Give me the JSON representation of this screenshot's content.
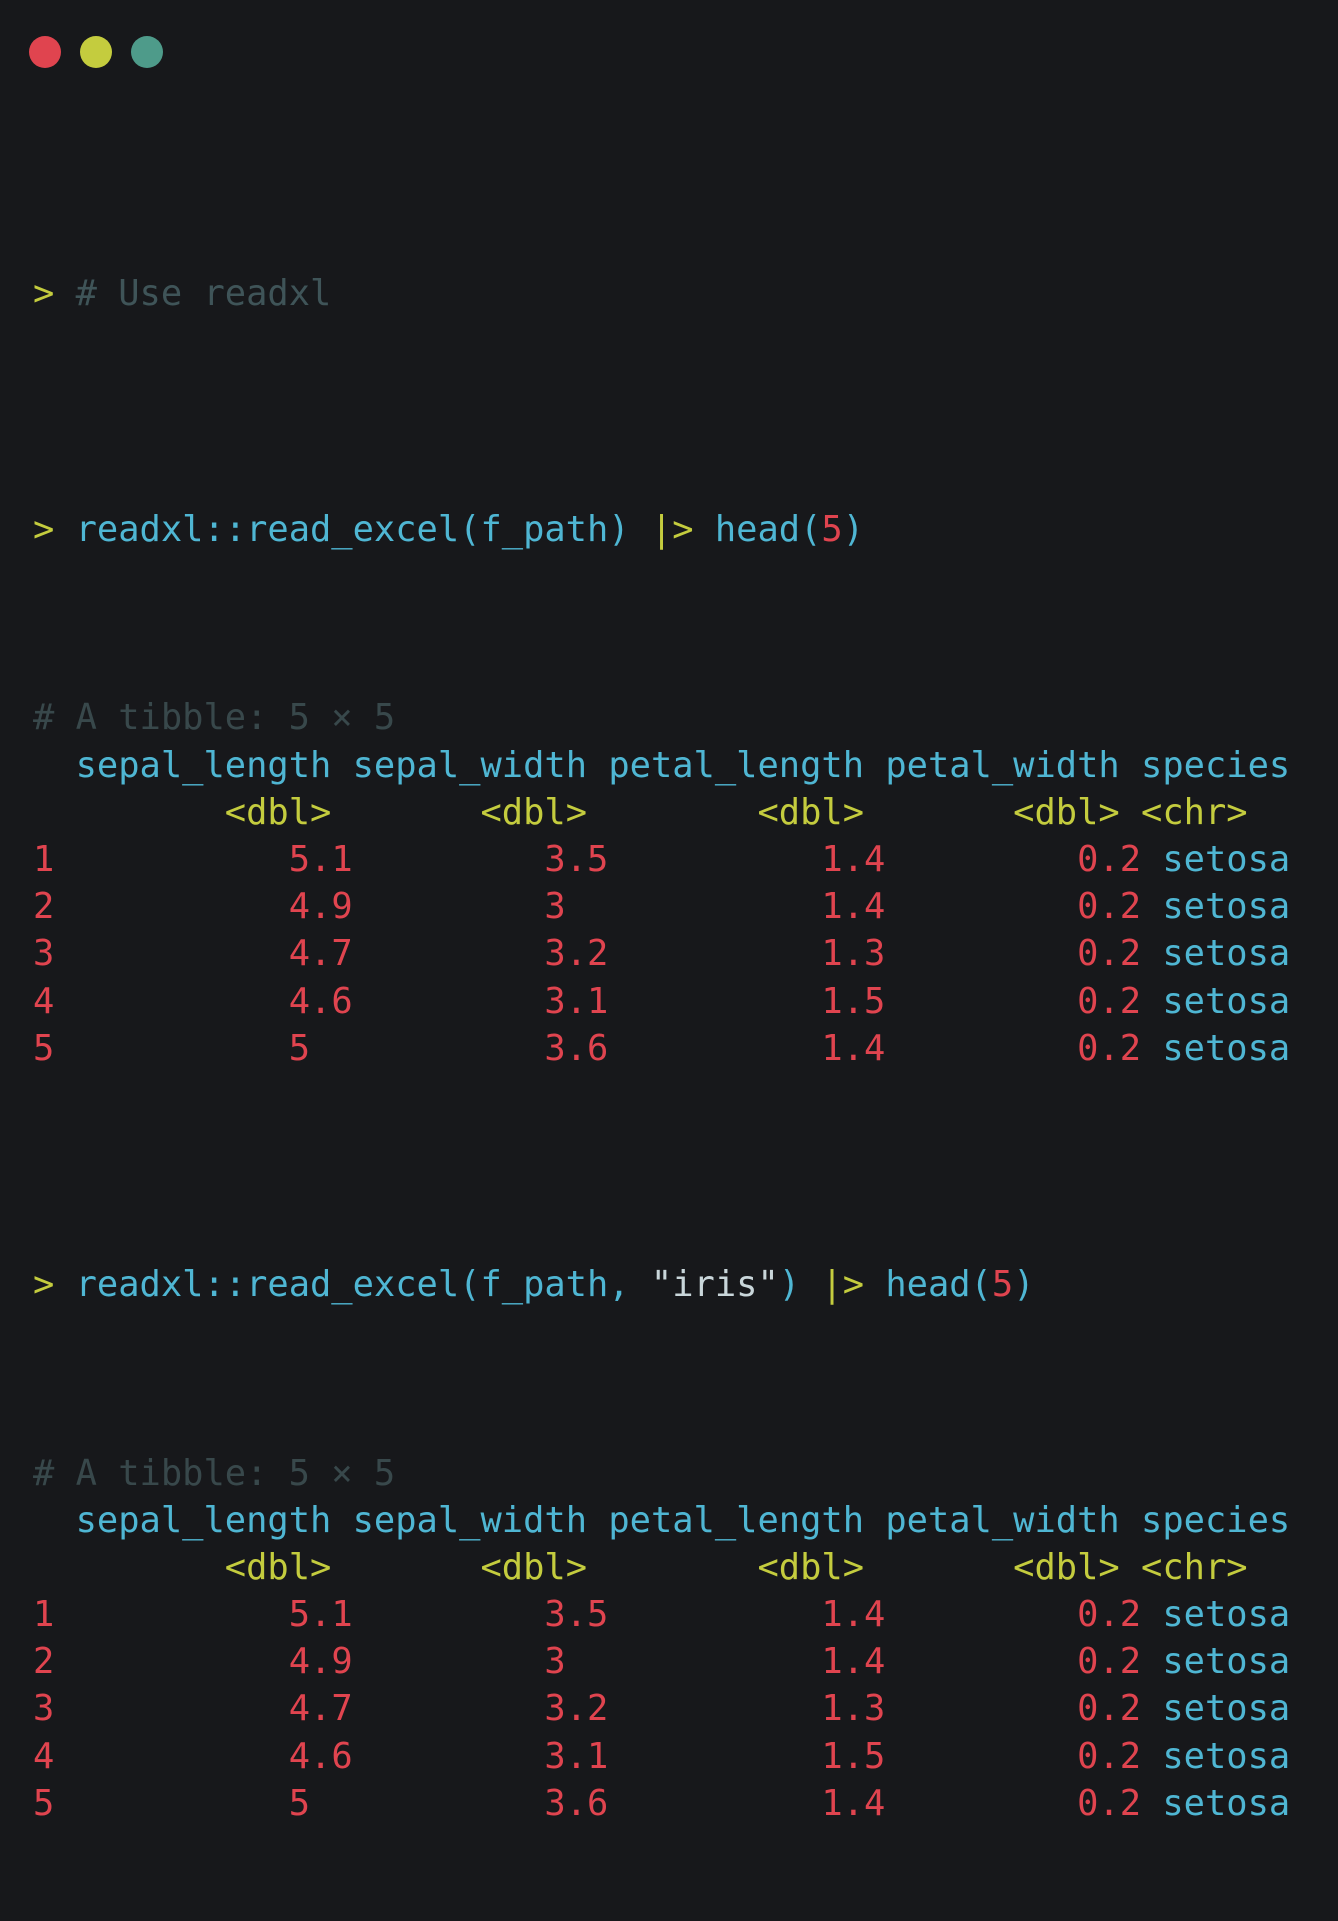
{
  "window_controls": {
    "close_color": "#e0444f",
    "minimize_color": "#c4cc3e",
    "zoom_color": "#4e9b8a"
  },
  "colors": {
    "background": "#17181b",
    "prompt": "#c4cc3e",
    "code": "#4fb6d3",
    "number": "#e0444f",
    "comment": "#3f5458"
  },
  "prompt": ">",
  "comment_line": "# Use readxl",
  "command1": {
    "fn": "readxl::read_excel(f_path)",
    "pipe": "|>",
    "head_fn": "head(",
    "head_arg": "5",
    "close": ")"
  },
  "command2": {
    "fn_open": "readxl::read_excel(f_path, ",
    "arg": "\"iris\"",
    "fn_close": ")",
    "pipe": "|>",
    "head_fn": "head(",
    "head_arg": "5",
    "close": ")"
  },
  "tibble_header": "# A tibble: 5 × 5",
  "columns": [
    "sepal_length",
    "sepal_width",
    "petal_length",
    "petal_width",
    "species"
  ],
  "types": [
    "<dbl>",
    "<dbl>",
    "<dbl>",
    "<dbl>",
    "<chr>"
  ],
  "rows": [
    {
      "n": "1",
      "sepal_length": "5.1",
      "sepal_width": "3.5",
      "petal_length": "1.4",
      "petal_width": "0.2",
      "species": "setosa"
    },
    {
      "n": "2",
      "sepal_length": "4.9",
      "sepal_width": "3",
      "petal_length": "1.4",
      "petal_width": "0.2",
      "species": "setosa"
    },
    {
      "n": "3",
      "sepal_length": "4.7",
      "sepal_width": "3.2",
      "petal_length": "1.3",
      "petal_width": "0.2",
      "species": "setosa"
    },
    {
      "n": "4",
      "sepal_length": "4.6",
      "sepal_width": "3.1",
      "petal_length": "1.5",
      "petal_width": "0.2",
      "species": "setosa"
    },
    {
      "n": "5",
      "sepal_length": "5",
      "sepal_width": "3.6",
      "petal_length": "1.4",
      "petal_width": "0.2",
      "species": "setosa"
    }
  ]
}
